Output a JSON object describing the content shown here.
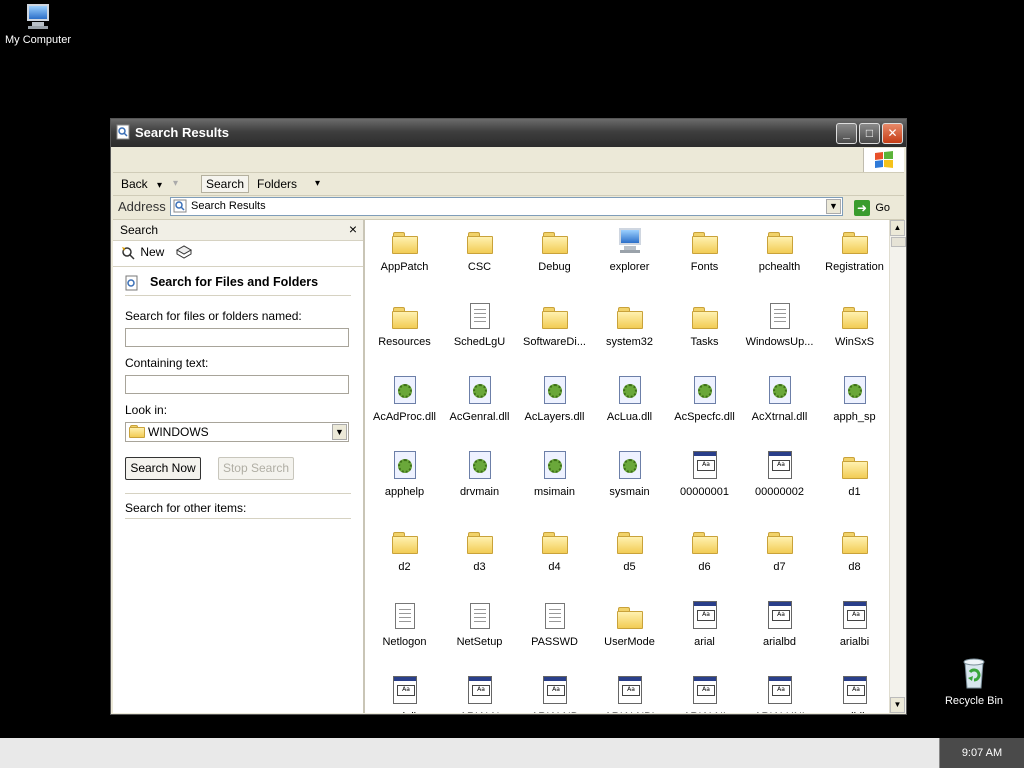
{
  "desktop": {
    "my_computer": "My Computer",
    "recycle_bin": "Recycle Bin"
  },
  "window": {
    "title": "Search Results",
    "buttons": {
      "minimize": "_",
      "maximize": "□",
      "close": "✕"
    }
  },
  "toolbar": {
    "back": "Back",
    "back_arrow": "▾",
    "fwd_arrow": "▾",
    "search": "Search",
    "folders": "Folders",
    "views_arrow": "▾"
  },
  "address": {
    "label": "Address",
    "value": "Search Results",
    "go": "Go"
  },
  "search_pane": {
    "title": "Search",
    "close": "×",
    "new": "New",
    "heading": "Search for Files and Folders",
    "named_label": "Search for files or folders named:",
    "named_value": "",
    "containing_label": "Containing text:",
    "containing_value": "",
    "look_in_label": "Look in:",
    "look_in_value": "WINDOWS",
    "search_now": "Search Now",
    "stop_search": "Stop Search",
    "other_items": "Search for other items:"
  },
  "results": [
    {
      "name": "AppPatch",
      "icon": "folder"
    },
    {
      "name": "CSC",
      "icon": "folder"
    },
    {
      "name": "Debug",
      "icon": "folder"
    },
    {
      "name": "explorer",
      "icon": "computer"
    },
    {
      "name": "Fonts",
      "icon": "folder"
    },
    {
      "name": "pchealth",
      "icon": "folder"
    },
    {
      "name": "Registration",
      "icon": "folder"
    },
    {
      "name": "Resources",
      "icon": "folder"
    },
    {
      "name": "SchedLgU",
      "icon": "document"
    },
    {
      "name": "SoftwareDi...",
      "icon": "folder"
    },
    {
      "name": "system32",
      "icon": "folder"
    },
    {
      "name": "Tasks",
      "icon": "folder"
    },
    {
      "name": "WindowsUp...",
      "icon": "document"
    },
    {
      "name": "WinSxS",
      "icon": "folder"
    },
    {
      "name": "AcAdProc.dll",
      "icon": "dll"
    },
    {
      "name": "AcGenral.dll",
      "icon": "dll"
    },
    {
      "name": "AcLayers.dll",
      "icon": "dll"
    },
    {
      "name": "AcLua.dll",
      "icon": "dll"
    },
    {
      "name": "AcSpecfc.dll",
      "icon": "dll"
    },
    {
      "name": "AcXtrnal.dll",
      "icon": "dll"
    },
    {
      "name": "apph_sp",
      "icon": "dll"
    },
    {
      "name": "apphelp",
      "icon": "dll"
    },
    {
      "name": "drvmain",
      "icon": "dll"
    },
    {
      "name": "msimain",
      "icon": "dll"
    },
    {
      "name": "sysmain",
      "icon": "dll"
    },
    {
      "name": "00000001",
      "icon": "font"
    },
    {
      "name": "00000002",
      "icon": "font"
    },
    {
      "name": "d1",
      "icon": "folder"
    },
    {
      "name": "d2",
      "icon": "folder"
    },
    {
      "name": "d3",
      "icon": "folder"
    },
    {
      "name": "d4",
      "icon": "folder"
    },
    {
      "name": "d5",
      "icon": "folder"
    },
    {
      "name": "d6",
      "icon": "folder"
    },
    {
      "name": "d7",
      "icon": "folder"
    },
    {
      "name": "d8",
      "icon": "folder"
    },
    {
      "name": "Netlogon",
      "icon": "document"
    },
    {
      "name": "NetSetup",
      "icon": "document"
    },
    {
      "name": "PASSWD",
      "icon": "document"
    },
    {
      "name": "UserMode",
      "icon": "folder"
    },
    {
      "name": "arial",
      "icon": "font"
    },
    {
      "name": "arialbd",
      "icon": "font"
    },
    {
      "name": "arialbi",
      "icon": "font"
    },
    {
      "name": "ariali",
      "icon": "font"
    },
    {
      "name": "ARIALN",
      "icon": "font"
    },
    {
      "name": "ARIALNB",
      "icon": "font"
    },
    {
      "name": "ARIALNBI",
      "icon": "font"
    },
    {
      "name": "ARIALNI",
      "icon": "font"
    },
    {
      "name": "ARIALUNI",
      "icon": "font"
    },
    {
      "name": "ariblk",
      "icon": "font"
    }
  ],
  "taskbar": {
    "clock": "9:07 AM"
  }
}
